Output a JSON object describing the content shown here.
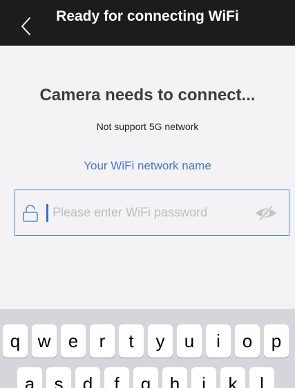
{
  "nav": {
    "title": "Ready for connecting WiFi",
    "back_icon": "chevron-left-icon"
  },
  "content": {
    "heading": "Camera needs to connect...",
    "note": "Not support 5G network",
    "network_name": "Your WiFi network name"
  },
  "password_field": {
    "value": "",
    "placeholder": "Please enter WiFi password",
    "lock_icon": "lock-icon",
    "visibility_icon": "eye-off-icon"
  },
  "keyboard": {
    "row1": [
      "q",
      "w",
      "e",
      "r",
      "t",
      "y",
      "u",
      "i",
      "o",
      "p"
    ],
    "row2": [
      "a",
      "s",
      "d",
      "f",
      "g",
      "h",
      "j",
      "k",
      "l"
    ]
  },
  "colors": {
    "nav_background": "#1c1c1c",
    "page_background": "#f3f3f5",
    "accent_blue": "#4e72d8",
    "keyboard_background": "#d4d6dc"
  }
}
